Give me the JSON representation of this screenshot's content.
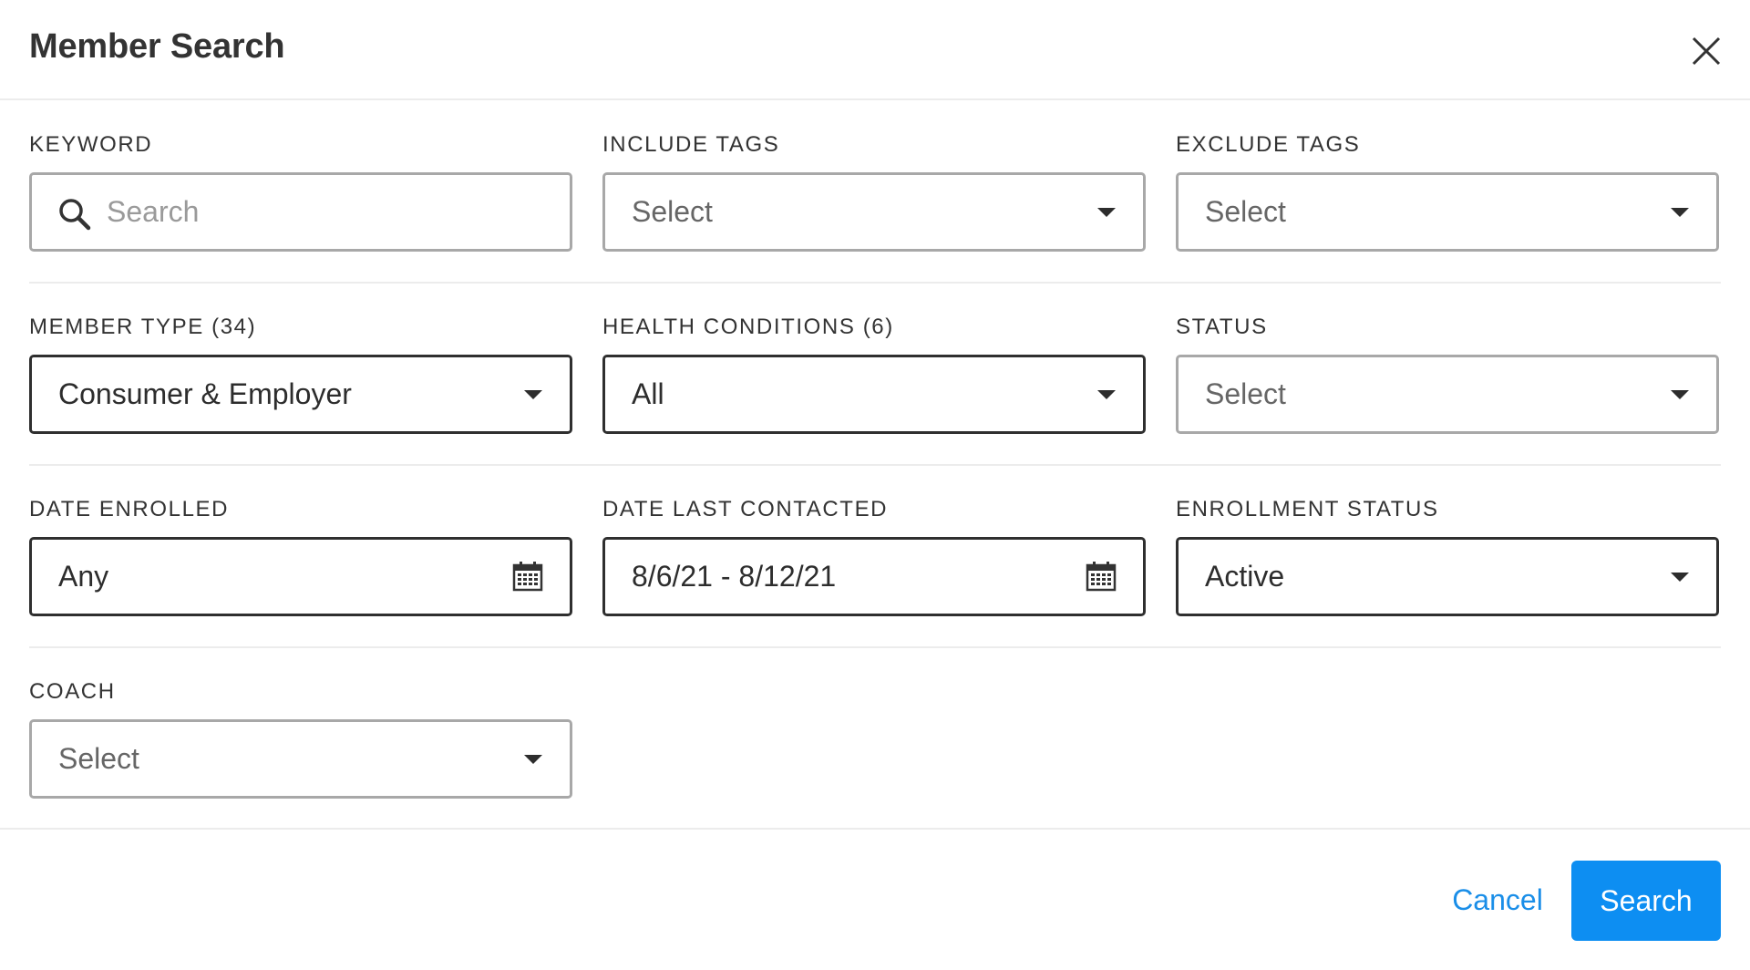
{
  "dialog": {
    "title": "Member Search"
  },
  "fields": {
    "keyword": {
      "label": "KEYWORD",
      "value": "",
      "placeholder": "Search"
    },
    "include_tags": {
      "label": "INCLUDE TAGS",
      "value": "Select"
    },
    "exclude_tags": {
      "label": "EXCLUDE TAGS",
      "value": "Select"
    },
    "member_type": {
      "label": "MEMBER TYPE (34)",
      "value": "Consumer & Employer"
    },
    "health_conditions": {
      "label": "HEALTH CONDITIONS (6)",
      "value": "All"
    },
    "status": {
      "label": "STATUS",
      "value": "Select"
    },
    "date_enrolled": {
      "label": "DATE ENROLLED",
      "value": "Any"
    },
    "date_last_contacted": {
      "label": "DATE LAST CONTACTED",
      "value": "8/6/21 - 8/12/21"
    },
    "enrollment_status": {
      "label": "ENROLLMENT STATUS",
      "value": "Active"
    },
    "coach": {
      "label": "COACH",
      "value": "Select"
    }
  },
  "footer": {
    "cancel_label": "Cancel",
    "search_label": "Search"
  },
  "colors": {
    "accent": "#0d8ef2",
    "link": "#1a8ee8",
    "border_default": "#a8a8a8",
    "border_active": "#2f2f2f"
  },
  "icons": {
    "close": "close-icon",
    "search": "search-icon",
    "caret": "chevron-down-icon",
    "calendar": "calendar-icon"
  }
}
